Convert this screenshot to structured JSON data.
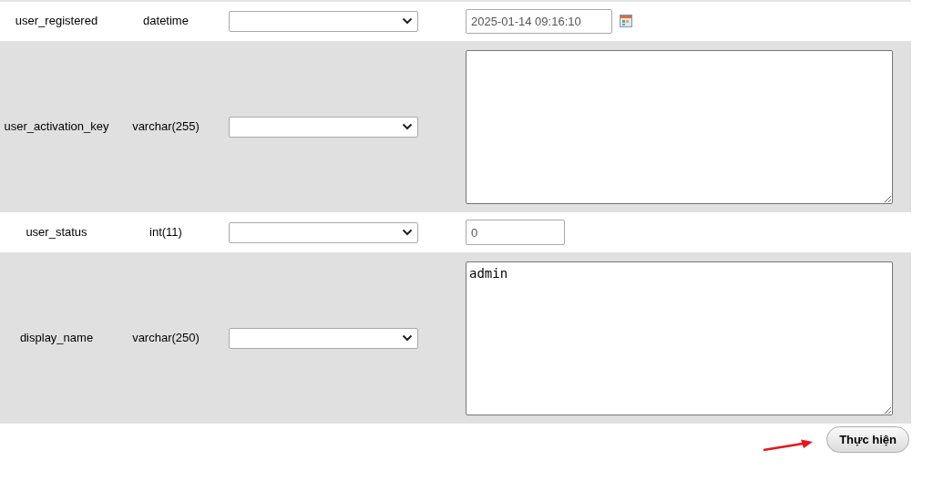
{
  "rows": [
    {
      "name": "user_registered",
      "type": "datetime",
      "kind": "datetime",
      "value": "2025-01-14 09:16:10"
    },
    {
      "name": "user_activation_key",
      "type": "varchar(255)",
      "kind": "textarea"
    },
    {
      "name": "user_status",
      "type": "int(11)",
      "kind": "number",
      "value": "0"
    },
    {
      "name": "display_name",
      "type": "varchar(250)",
      "kind": "textarea",
      "value": "admin"
    }
  ],
  "submit": "Thực hiện"
}
